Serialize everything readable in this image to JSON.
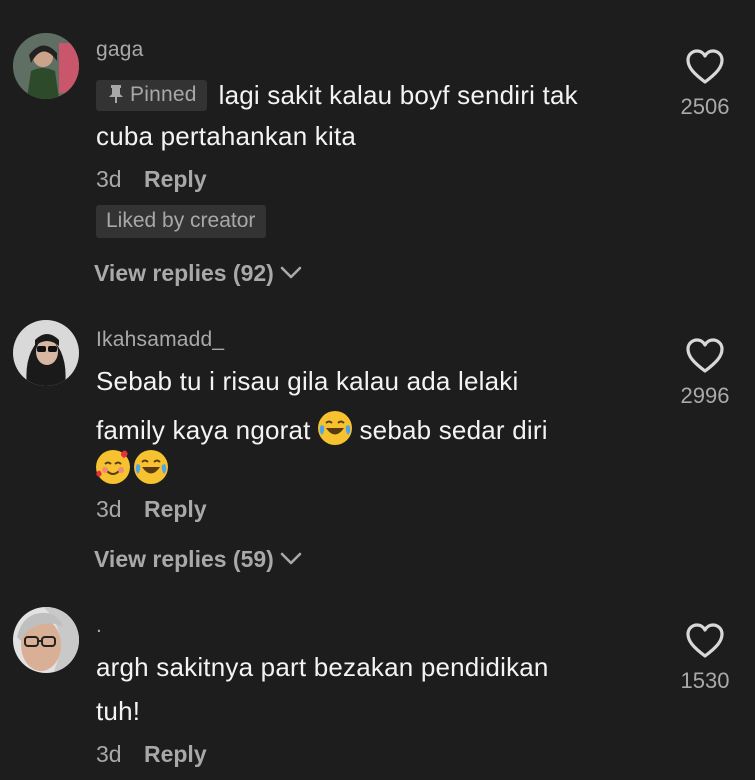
{
  "comments": [
    {
      "username": "gaga",
      "pinned_label": "Pinned",
      "text_line1": "lagi sakit kalau boyf sendiri tak",
      "text_line2": "cuba pertahankan kita",
      "date": "3d",
      "reply_label": "Reply",
      "liked_label": "Liked by creator",
      "view_replies": "View replies (92)",
      "like_count": "2506"
    },
    {
      "username": "Ikahsamadd_",
      "text_line1": "Sebab tu i risau gila kalau ada lelaki",
      "text_line2_a": "family kaya ngorat",
      "text_line2_b": "sebab sedar diri",
      "date": "3d",
      "reply_label": "Reply",
      "view_replies": "View replies (59)",
      "like_count": "2996"
    },
    {
      "username": ".",
      "text_line1": "argh sakitnya part bezakan pendidikan",
      "text_line2": "tuh!",
      "date": "3d",
      "reply_label": "Reply",
      "like_count": "1530"
    }
  ],
  "icons": {
    "like": "heart-outline-icon",
    "pin": "pin-icon",
    "chevron": "chevron-down-icon",
    "emoji_laugh": "tears-of-joy-emoji",
    "emoji_love": "smiling-face-with-hearts-emoji"
  },
  "colors": {
    "background": "#1d1d1d",
    "primary_text": "#f3f3f3",
    "secondary_text": "#a9a9a9",
    "badge_bg": "#333333"
  }
}
